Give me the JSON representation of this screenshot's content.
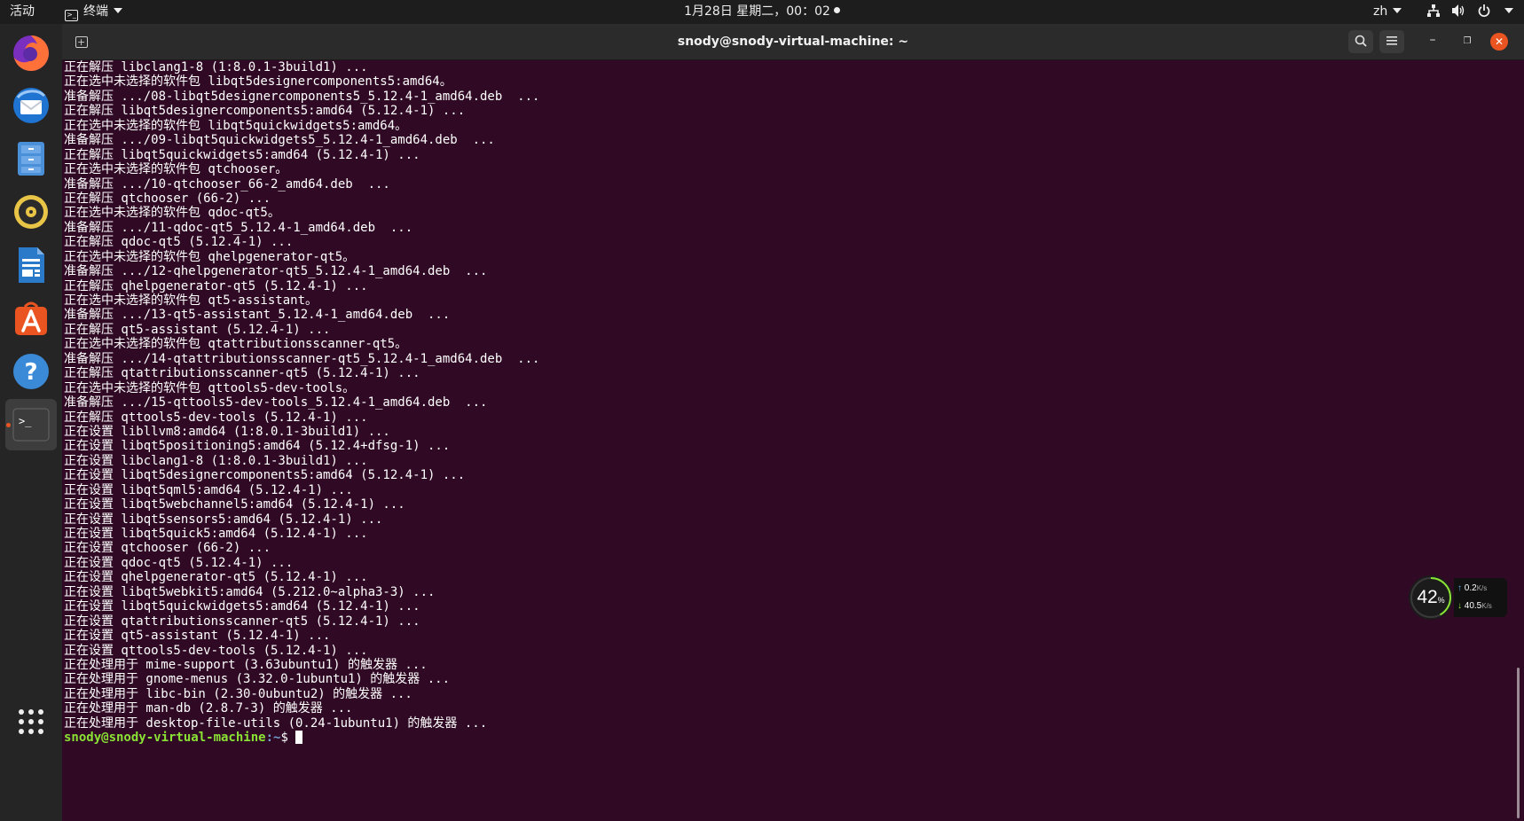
{
  "topbar": {
    "activities": "活动",
    "app_menu": "终端",
    "clock": "1月28日 星期二，00：02",
    "language": "zh"
  },
  "dock": {
    "items": [
      {
        "name": "firefox"
      },
      {
        "name": "thunderbird"
      },
      {
        "name": "files"
      },
      {
        "name": "rhythmbox"
      },
      {
        "name": "libreoffice-writer"
      },
      {
        "name": "ubuntu-software"
      },
      {
        "name": "help"
      },
      {
        "name": "terminal",
        "active": true
      },
      {
        "name": "show-applications"
      }
    ]
  },
  "window": {
    "title": "snody@snody-virtual-machine: ~"
  },
  "terminal": {
    "lines": [
      "正在解压 libclang1-8 (1:8.0.1-3build1) ...",
      "正在选中未选择的软件包 libqt5designercomponents5:amd64。",
      "准备解压 .../08-libqt5designercomponents5_5.12.4-1_amd64.deb  ...",
      "正在解压 libqt5designercomponents5:amd64 (5.12.4-1) ...",
      "正在选中未选择的软件包 libqt5quickwidgets5:amd64。",
      "准备解压 .../09-libqt5quickwidgets5_5.12.4-1_amd64.deb  ...",
      "正在解压 libqt5quickwidgets5:amd64 (5.12.4-1) ...",
      "正在选中未选择的软件包 qtchooser。",
      "准备解压 .../10-qtchooser_66-2_amd64.deb  ...",
      "正在解压 qtchooser (66-2) ...",
      "正在选中未选择的软件包 qdoc-qt5。",
      "准备解压 .../11-qdoc-qt5_5.12.4-1_amd64.deb  ...",
      "正在解压 qdoc-qt5 (5.12.4-1) ...",
      "正在选中未选择的软件包 qhelpgenerator-qt5。",
      "准备解压 .../12-qhelpgenerator-qt5_5.12.4-1_amd64.deb  ...",
      "正在解压 qhelpgenerator-qt5 (5.12.4-1) ...",
      "正在选中未选择的软件包 qt5-assistant。",
      "准备解压 .../13-qt5-assistant_5.12.4-1_amd64.deb  ...",
      "正在解压 qt5-assistant (5.12.4-1) ...",
      "正在选中未选择的软件包 qtattributionsscanner-qt5。",
      "准备解压 .../14-qtattributionsscanner-qt5_5.12.4-1_amd64.deb  ...",
      "正在解压 qtattributionsscanner-qt5 (5.12.4-1) ...",
      "正在选中未选择的软件包 qttools5-dev-tools。",
      "准备解压 .../15-qttools5-dev-tools_5.12.4-1_amd64.deb  ...",
      "正在解压 qttools5-dev-tools (5.12.4-1) ...",
      "正在设置 libllvm8:amd64 (1:8.0.1-3build1) ...",
      "正在设置 libqt5positioning5:amd64 (5.12.4+dfsg-1) ...",
      "正在设置 libclang1-8 (1:8.0.1-3build1) ...",
      "正在设置 libqt5designercomponents5:amd64 (5.12.4-1) ...",
      "正在设置 libqt5qml5:amd64 (5.12.4-1) ...",
      "正在设置 libqt5webchannel5:amd64 (5.12.4-1) ...",
      "正在设置 libqt5sensors5:amd64 (5.12.4-1) ...",
      "正在设置 libqt5quick5:amd64 (5.12.4-1) ...",
      "正在设置 qtchooser (66-2) ...",
      "正在设置 qdoc-qt5 (5.12.4-1) ...",
      "正在设置 qhelpgenerator-qt5 (5.12.4-1) ...",
      "正在设置 libqt5webkit5:amd64 (5.212.0~alpha3-3) ...",
      "正在设置 libqt5quickwidgets5:amd64 (5.12.4-1) ...",
      "正在设置 qtattributionsscanner-qt5 (5.12.4-1) ...",
      "正在设置 qt5-assistant (5.12.4-1) ...",
      "正在设置 qttools5-dev-tools (5.12.4-1) ...",
      "正在处理用于 mime-support (3.63ubuntu1) 的触发器 ...",
      "正在处理用于 gnome-menus (3.32.0-1ubuntu1) 的触发器 ...",
      "正在处理用于 libc-bin (2.30-0ubuntu2) 的触发器 ...",
      "正在处理用于 man-db (2.8.7-3) 的触发器 ...",
      "正在处理用于 desktop-file-utils (0.24-1ubuntu1) 的触发器 ..."
    ],
    "prompt_user": "snody@snody-virtual-machine",
    "prompt_path": ":~",
    "prompt_symbol": "$ "
  },
  "net_widget": {
    "percent": "42",
    "percent_unit": "%",
    "percent_value": 0.42,
    "upload": "0.2",
    "upload_unit": "K/s",
    "download": "40.5",
    "download_unit": "K/s",
    "colors": {
      "ring": "#8ae234",
      "ring_track": "#3a3a3a"
    }
  },
  "colors": {
    "terminal_bg": "#300a24",
    "prompt_user": "#8ae234",
    "prompt_path": "#729fcf",
    "accent": "#e95420"
  }
}
